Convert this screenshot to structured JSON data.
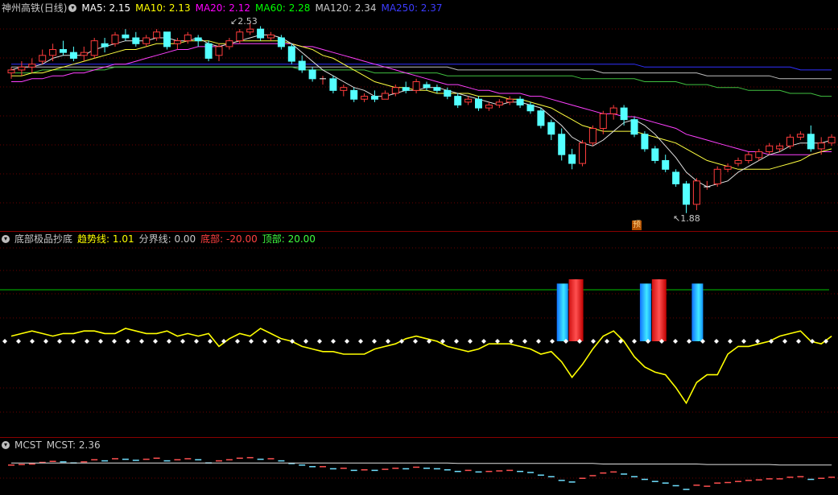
{
  "main": {
    "stock": "神州高铁",
    "period": "(日线)",
    "ma": [
      {
        "label": "MA5: 2.15",
        "color": "#ffffff"
      },
      {
        "label": "MA10: 2.13",
        "color": "#ffff00"
      },
      {
        "label": "MA20: 2.12",
        "color": "#ff00ff"
      },
      {
        "label": "MA60: 2.28",
        "color": "#00ff00"
      },
      {
        "label": "MA120: 2.34",
        "color": "#c8c8c8"
      },
      {
        "label": "MA250: 2.37",
        "color": "#3c3cff"
      }
    ],
    "high_label": "2.53",
    "low_label": "1.88",
    "warn_badge": "预",
    "candles": [
      [
        2.36,
        2.38,
        2.34,
        2.37
      ],
      [
        2.37,
        2.4,
        2.35,
        2.38
      ],
      [
        2.38,
        2.41,
        2.36,
        2.39
      ],
      [
        2.4,
        2.44,
        2.39,
        2.42
      ],
      [
        2.42,
        2.46,
        2.4,
        2.44
      ],
      [
        2.44,
        2.47,
        2.42,
        2.43
      ],
      [
        2.43,
        2.45,
        2.4,
        2.41
      ],
      [
        2.42,
        2.45,
        2.4,
        2.43
      ],
      [
        2.42,
        2.48,
        2.41,
        2.47
      ],
      [
        2.46,
        2.48,
        2.43,
        2.45
      ],
      [
        2.46,
        2.5,
        2.45,
        2.49
      ],
      [
        2.49,
        2.51,
        2.47,
        2.48
      ],
      [
        2.48,
        2.5,
        2.45,
        2.46
      ],
      [
        2.46,
        2.49,
        2.45,
        2.48
      ],
      [
        2.48,
        2.51,
        2.47,
        2.5
      ],
      [
        2.5,
        2.5,
        2.44,
        2.45
      ],
      [
        2.46,
        2.48,
        2.44,
        2.47
      ],
      [
        2.47,
        2.5,
        2.46,
        2.49
      ],
      [
        2.48,
        2.49,
        2.45,
        2.47
      ],
      [
        2.46,
        2.47,
        2.4,
        2.41
      ],
      [
        2.42,
        2.46,
        2.4,
        2.45
      ],
      [
        2.45,
        2.48,
        2.44,
        2.47
      ],
      [
        2.47,
        2.51,
        2.46,
        2.5
      ],
      [
        2.5,
        2.53,
        2.49,
        2.51
      ],
      [
        2.51,
        2.52,
        2.47,
        2.48
      ],
      [
        2.48,
        2.5,
        2.47,
        2.49
      ],
      [
        2.48,
        2.49,
        2.44,
        2.45
      ],
      [
        2.45,
        2.46,
        2.39,
        2.4
      ],
      [
        2.4,
        2.42,
        2.36,
        2.37
      ],
      [
        2.37,
        2.38,
        2.33,
        2.34
      ],
      [
        2.34,
        2.35,
        2.32,
        2.34
      ],
      [
        2.34,
        2.35,
        2.29,
        2.3
      ],
      [
        2.3,
        2.32,
        2.28,
        2.31
      ],
      [
        2.3,
        2.31,
        2.26,
        2.27
      ],
      [
        2.27,
        2.29,
        2.26,
        2.28
      ],
      [
        2.28,
        2.3,
        2.26,
        2.27
      ],
      [
        2.27,
        2.3,
        2.27,
        2.29
      ],
      [
        2.29,
        2.32,
        2.28,
        2.31
      ],
      [
        2.31,
        2.33,
        2.29,
        2.3
      ],
      [
        2.3,
        2.34,
        2.29,
        2.33
      ],
      [
        2.32,
        2.33,
        2.3,
        2.31
      ],
      [
        2.31,
        2.32,
        2.29,
        2.3
      ],
      [
        2.3,
        2.31,
        2.27,
        2.28
      ],
      [
        2.28,
        2.29,
        2.24,
        2.25
      ],
      [
        2.26,
        2.28,
        2.25,
        2.27
      ],
      [
        2.27,
        2.28,
        2.23,
        2.24
      ],
      [
        2.24,
        2.26,
        2.23,
        2.25
      ],
      [
        2.25,
        2.27,
        2.24,
        2.26
      ],
      [
        2.26,
        2.28,
        2.25,
        2.27
      ],
      [
        2.27,
        2.28,
        2.24,
        2.25
      ],
      [
        2.25,
        2.26,
        2.22,
        2.23
      ],
      [
        2.23,
        2.24,
        2.17,
        2.18
      ],
      [
        2.19,
        2.2,
        2.13,
        2.15
      ],
      [
        2.15,
        2.17,
        2.06,
        2.08
      ],
      [
        2.08,
        2.1,
        2.03,
        2.05
      ],
      [
        2.05,
        2.13,
        2.04,
        2.12
      ],
      [
        2.12,
        2.18,
        2.11,
        2.17
      ],
      [
        2.17,
        2.23,
        2.15,
        2.22
      ],
      [
        2.22,
        2.25,
        2.2,
        2.24
      ],
      [
        2.24,
        2.25,
        2.18,
        2.2
      ],
      [
        2.2,
        2.21,
        2.14,
        2.15
      ],
      [
        2.15,
        2.16,
        2.09,
        2.1
      ],
      [
        2.1,
        2.11,
        2.05,
        2.06
      ],
      [
        2.06,
        2.08,
        2.02,
        2.03
      ],
      [
        2.02,
        2.03,
        1.97,
        1.98
      ],
      [
        1.98,
        1.99,
        1.88,
        1.91
      ],
      [
        1.91,
        2.0,
        1.89,
        1.99
      ],
      [
        1.97,
        1.99,
        1.96,
        1.97
      ],
      [
        1.98,
        2.04,
        1.97,
        2.03
      ],
      [
        2.03,
        2.05,
        2.02,
        2.04
      ],
      [
        2.05,
        2.07,
        2.04,
        2.06
      ],
      [
        2.06,
        2.09,
        2.05,
        2.08
      ],
      [
        2.07,
        2.1,
        2.06,
        2.09
      ],
      [
        2.09,
        2.12,
        2.08,
        2.11
      ],
      [
        2.1,
        2.12,
        2.09,
        2.11
      ],
      [
        2.11,
        2.15,
        2.1,
        2.14
      ],
      [
        2.14,
        2.16,
        2.13,
        2.15
      ],
      [
        2.15,
        2.18,
        2.09,
        2.1
      ],
      [
        2.1,
        2.14,
        2.08,
        2.12
      ],
      [
        2.12,
        2.15,
        2.11,
        2.14
      ]
    ],
    "ma_series": {
      "ma5": [
        2.37,
        2.38,
        2.38,
        2.39,
        2.41,
        2.42,
        2.42,
        2.42,
        2.44,
        2.45,
        2.46,
        2.47,
        2.47,
        2.47,
        2.48,
        2.48,
        2.47,
        2.47,
        2.48,
        2.46,
        2.45,
        2.46,
        2.47,
        2.48,
        2.49,
        2.49,
        2.48,
        2.46,
        2.43,
        2.4,
        2.37,
        2.35,
        2.33,
        2.31,
        2.3,
        2.28,
        2.28,
        2.29,
        2.3,
        2.3,
        2.31,
        2.31,
        2.3,
        2.29,
        2.28,
        2.27,
        2.26,
        2.25,
        2.26,
        2.26,
        2.25,
        2.24,
        2.21,
        2.18,
        2.14,
        2.12,
        2.11,
        2.13,
        2.16,
        2.19,
        2.2,
        2.18,
        2.15,
        2.11,
        2.07,
        2.02,
        1.99,
        1.97,
        1.98,
        1.99,
        2.02,
        2.04,
        2.06,
        2.08,
        2.09,
        2.11,
        2.12,
        2.12,
        2.12,
        2.13
      ],
      "ma10": [
        2.35,
        2.35,
        2.36,
        2.36,
        2.37,
        2.38,
        2.39,
        2.4,
        2.41,
        2.42,
        2.43,
        2.44,
        2.44,
        2.45,
        2.46,
        2.46,
        2.46,
        2.47,
        2.47,
        2.47,
        2.46,
        2.46,
        2.47,
        2.47,
        2.47,
        2.47,
        2.47,
        2.46,
        2.45,
        2.44,
        2.42,
        2.41,
        2.39,
        2.37,
        2.35,
        2.33,
        2.32,
        2.31,
        2.31,
        2.3,
        2.3,
        2.29,
        2.29,
        2.29,
        2.29,
        2.28,
        2.28,
        2.28,
        2.27,
        2.27,
        2.26,
        2.25,
        2.24,
        2.22,
        2.2,
        2.18,
        2.17,
        2.16,
        2.16,
        2.16,
        2.16,
        2.15,
        2.14,
        2.13,
        2.12,
        2.1,
        2.08,
        2.06,
        2.05,
        2.04,
        2.03,
        2.03,
        2.03,
        2.03,
        2.04,
        2.05,
        2.06,
        2.08,
        2.09,
        2.1
      ],
      "ma20": [
        2.33,
        2.33,
        2.34,
        2.34,
        2.35,
        2.35,
        2.36,
        2.36,
        2.37,
        2.38,
        2.39,
        2.39,
        2.4,
        2.41,
        2.42,
        2.43,
        2.44,
        2.44,
        2.45,
        2.45,
        2.45,
        2.46,
        2.46,
        2.46,
        2.46,
        2.46,
        2.46,
        2.46,
        2.45,
        2.45,
        2.44,
        2.43,
        2.42,
        2.41,
        2.4,
        2.39,
        2.38,
        2.37,
        2.36,
        2.35,
        2.34,
        2.33,
        2.32,
        2.32,
        2.31,
        2.3,
        2.3,
        2.29,
        2.29,
        2.29,
        2.28,
        2.28,
        2.27,
        2.26,
        2.25,
        2.24,
        2.23,
        2.22,
        2.22,
        2.21,
        2.21,
        2.2,
        2.19,
        2.18,
        2.17,
        2.15,
        2.14,
        2.13,
        2.12,
        2.11,
        2.1,
        2.09,
        2.09,
        2.08,
        2.08,
        2.08,
        2.08,
        2.08,
        2.09,
        2.09
      ],
      "ma60": [
        2.36,
        2.36,
        2.36,
        2.37,
        2.37,
        2.37,
        2.37,
        2.37,
        2.37,
        2.37,
        2.38,
        2.38,
        2.38,
        2.38,
        2.38,
        2.38,
        2.38,
        2.38,
        2.38,
        2.38,
        2.38,
        2.38,
        2.38,
        2.38,
        2.38,
        2.38,
        2.38,
        2.38,
        2.37,
        2.37,
        2.37,
        2.37,
        2.37,
        2.37,
        2.37,
        2.36,
        2.36,
        2.36,
        2.36,
        2.36,
        2.36,
        2.36,
        2.35,
        2.35,
        2.35,
        2.35,
        2.35,
        2.35,
        2.35,
        2.35,
        2.35,
        2.35,
        2.35,
        2.35,
        2.35,
        2.34,
        2.34,
        2.34,
        2.34,
        2.34,
        2.34,
        2.33,
        2.33,
        2.33,
        2.33,
        2.32,
        2.32,
        2.32,
        2.31,
        2.31,
        2.31,
        2.3,
        2.3,
        2.3,
        2.3,
        2.29,
        2.29,
        2.29,
        2.28,
        2.28
      ],
      "ma120": [
        2.38,
        2.38,
        2.38,
        2.38,
        2.38,
        2.38,
        2.38,
        2.38,
        2.38,
        2.38,
        2.38,
        2.38,
        2.38,
        2.38,
        2.38,
        2.38,
        2.38,
        2.38,
        2.38,
        2.38,
        2.38,
        2.38,
        2.38,
        2.38,
        2.38,
        2.38,
        2.38,
        2.38,
        2.38,
        2.38,
        2.38,
        2.38,
        2.38,
        2.38,
        2.38,
        2.38,
        2.38,
        2.38,
        2.38,
        2.38,
        2.38,
        2.38,
        2.38,
        2.37,
        2.37,
        2.37,
        2.37,
        2.37,
        2.37,
        2.37,
        2.37,
        2.37,
        2.37,
        2.37,
        2.37,
        2.37,
        2.37,
        2.36,
        2.36,
        2.36,
        2.36,
        2.36,
        2.36,
        2.36,
        2.36,
        2.36,
        2.36,
        2.35,
        2.35,
        2.35,
        2.35,
        2.35,
        2.35,
        2.35,
        2.34,
        2.34,
        2.34,
        2.34,
        2.34,
        2.34
      ],
      "ma250": [
        2.39,
        2.39,
        2.39,
        2.39,
        2.39,
        2.39,
        2.39,
        2.39,
        2.39,
        2.39,
        2.39,
        2.39,
        2.39,
        2.39,
        2.39,
        2.39,
        2.39,
        2.39,
        2.39,
        2.39,
        2.39,
        2.39,
        2.39,
        2.39,
        2.39,
        2.39,
        2.39,
        2.39,
        2.39,
        2.39,
        2.39,
        2.39,
        2.39,
        2.39,
        2.39,
        2.39,
        2.39,
        2.39,
        2.39,
        2.39,
        2.39,
        2.39,
        2.39,
        2.39,
        2.39,
        2.39,
        2.39,
        2.39,
        2.39,
        2.39,
        2.39,
        2.39,
        2.39,
        2.39,
        2.39,
        2.39,
        2.39,
        2.39,
        2.39,
        2.39,
        2.39,
        2.38,
        2.38,
        2.38,
        2.38,
        2.38,
        2.38,
        2.38,
        2.38,
        2.38,
        2.38,
        2.38,
        2.38,
        2.38,
        2.38,
        2.38,
        2.37,
        2.37,
        2.37,
        2.37
      ]
    }
  },
  "indicator": {
    "name": "底部极品抄底",
    "items": [
      {
        "label": "趋势线: 1.01",
        "color": "#ffff00"
      },
      {
        "label": "分界线: 0.00",
        "color": "#c8c8c8"
      },
      {
        "label": "底部: -20.00",
        "color": "#ff4040"
      },
      {
        "label": "顶部: 20.00",
        "color": "#40ff40"
      }
    ],
    "trend": [
      2,
      3,
      4,
      3,
      2,
      3,
      3,
      4,
      4,
      3,
      3,
      5,
      4,
      3,
      3,
      4,
      2,
      3,
      2,
      3,
      -2,
      1,
      3,
      2,
      5,
      3,
      1,
      0,
      -2,
      -3,
      -4,
      -4,
      -5,
      -5,
      -5,
      -3,
      -2,
      -1,
      1,
      2,
      1,
      0,
      -2,
      -3,
      -4,
      -3,
      -1,
      -1,
      -1,
      -2,
      -3,
      -5,
      -4,
      -8,
      -14,
      -9,
      -3,
      2,
      4,
      0,
      -6,
      -10,
      -12,
      -13,
      -18,
      -24,
      -16,
      -13,
      -13,
      -5,
      -2,
      -2,
      -1,
      0,
      2,
      3,
      4,
      0,
      -1,
      2
    ],
    "blue_bars": [
      {
        "i": 53,
        "v": 7
      },
      {
        "i": 61,
        "v": 7
      },
      {
        "i": 66,
        "v": 7
      }
    ],
    "red_bars": [
      {
        "i": 54,
        "v": 22
      },
      {
        "i": 62,
        "v": 22
      }
    ]
  },
  "mcst": {
    "name": "MCST",
    "value": "MCST: 2.36"
  }
}
